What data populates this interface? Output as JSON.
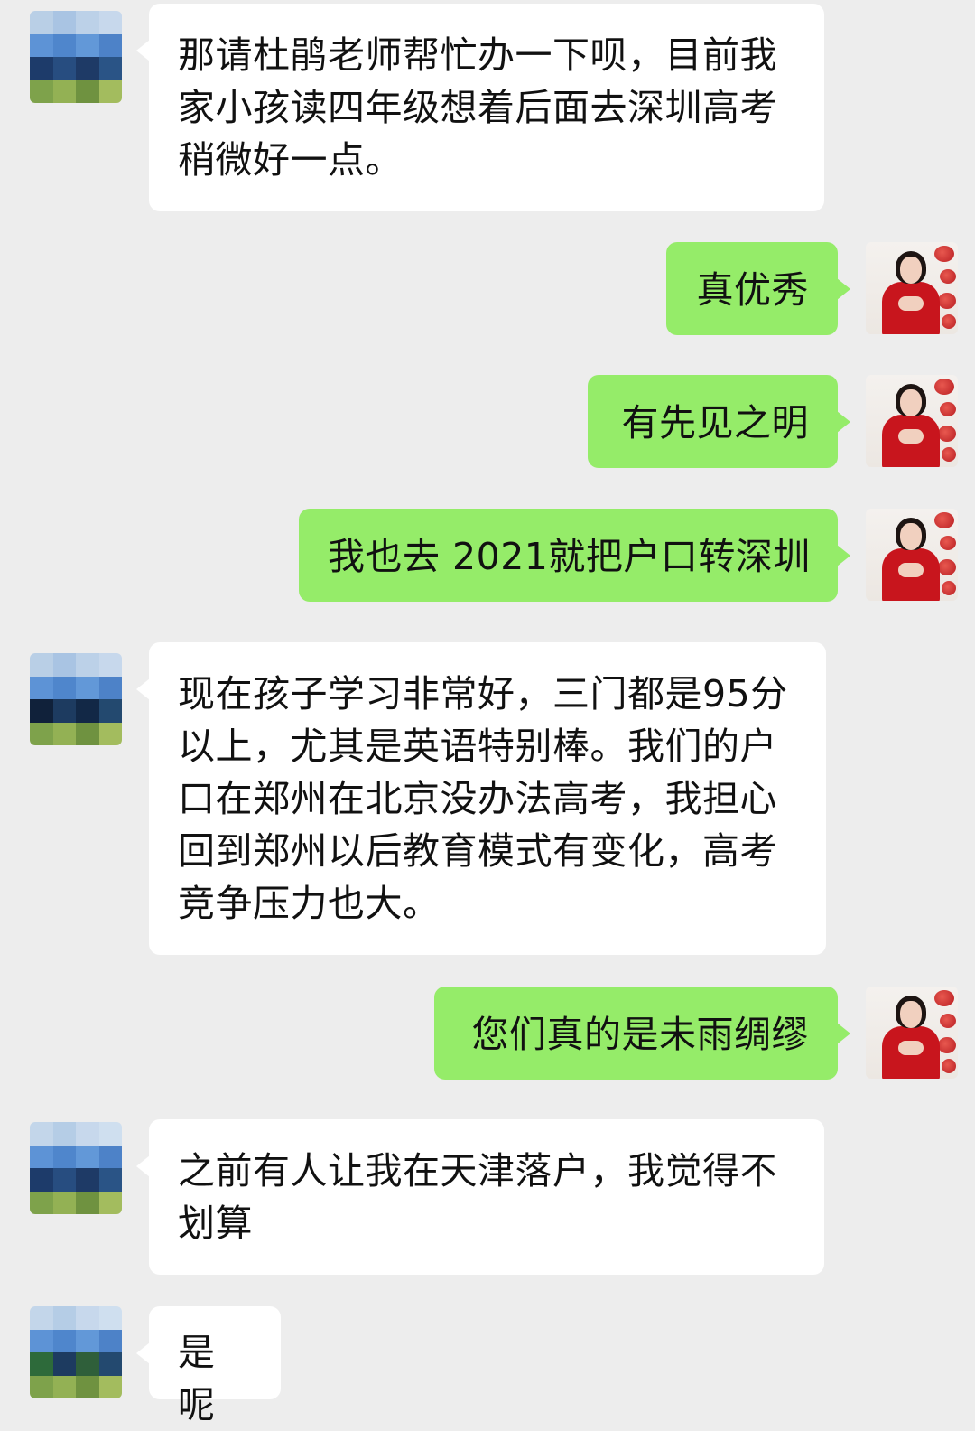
{
  "messages": [
    {
      "side": "left",
      "text": "那请杜鹃老师帮忙办一下呗，目前我家小孩读四年级想着后面去深圳高考稍微好一点。"
    },
    {
      "side": "right",
      "text": "真优秀"
    },
    {
      "side": "right",
      "text": "有先见之明"
    },
    {
      "side": "right",
      "text": "我也去 2021就把户口转深圳"
    },
    {
      "side": "left",
      "text": "现在孩子学习非常好，三门都是95分以上，尤其是英语特别棒。我们的户口在郑州在北京没办法高考，我担心回到郑州以后教育模式有变化，高考竞争压力也大。"
    },
    {
      "side": "right",
      "text": "您们真的是未雨绸缪"
    },
    {
      "side": "left",
      "text": "之前有人让我在天津落户，我觉得不划算"
    },
    {
      "side": "left",
      "text": "是呢"
    }
  ],
  "colors": {
    "background": "#ededed",
    "incoming_bubble": "#ffffff",
    "outgoing_bubble": "#95ec69"
  },
  "icons": {
    "contact_avatar": "pixelated-landscape-avatar",
    "self_avatar": "woman-in-red-qipao-avatar"
  }
}
